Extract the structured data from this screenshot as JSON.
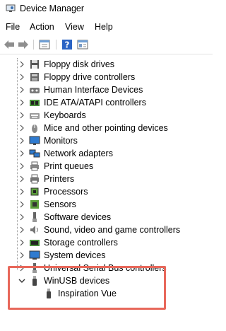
{
  "window": {
    "title": "Device Manager"
  },
  "menu": [
    "File",
    "Action",
    "View",
    "Help"
  ],
  "toolbar": [
    {
      "icon": "back-arrow-icon"
    },
    {
      "icon": "forward-arrow-icon"
    },
    {
      "icon": "properties-icon"
    },
    {
      "icon": "help-icon"
    },
    {
      "icon": "update-driver-icon"
    }
  ],
  "tree": [
    {
      "label": "Floppy disk drives",
      "icon": "floppy-disk-icon",
      "expanded": false
    },
    {
      "label": "Floppy drive controllers",
      "icon": "floppy-controller-icon",
      "expanded": false
    },
    {
      "label": "Human Interface Devices",
      "icon": "hid-icon",
      "expanded": false
    },
    {
      "label": "IDE ATA/ATAPI controllers",
      "icon": "ide-controller-icon",
      "expanded": false
    },
    {
      "label": "Keyboards",
      "icon": "keyboard-icon",
      "expanded": false
    },
    {
      "label": "Mice and other pointing devices",
      "icon": "mouse-icon",
      "expanded": false
    },
    {
      "label": "Monitors",
      "icon": "monitor-icon",
      "expanded": false
    },
    {
      "label": "Network adapters",
      "icon": "network-adapter-icon",
      "expanded": false
    },
    {
      "label": "Print queues",
      "icon": "print-queue-icon",
      "expanded": false
    },
    {
      "label": "Printers",
      "icon": "printer-icon",
      "expanded": false
    },
    {
      "label": "Processors",
      "icon": "processor-icon",
      "expanded": false
    },
    {
      "label": "Sensors",
      "icon": "sensor-icon",
      "expanded": false
    },
    {
      "label": "Software devices",
      "icon": "software-device-icon",
      "expanded": false
    },
    {
      "label": "Sound, video and game controllers",
      "icon": "sound-icon",
      "expanded": false
    },
    {
      "label": "Storage controllers",
      "icon": "storage-controller-icon",
      "expanded": false
    },
    {
      "label": "System devices",
      "icon": "system-device-icon",
      "expanded": false
    },
    {
      "label": "Universal Serial Bus controllers",
      "icon": "usb-controller-icon",
      "expanded": false
    },
    {
      "label": "WinUSB devices",
      "icon": "usb-device-icon",
      "expanded": true
    },
    {
      "label": "Inspiration Vue",
      "icon": "usb-device-icon",
      "child": true
    }
  ],
  "colors": {
    "highlight": "#e8685b",
    "icon_blue": "#2f7bd0",
    "icon_green": "#5c9e3c"
  }
}
